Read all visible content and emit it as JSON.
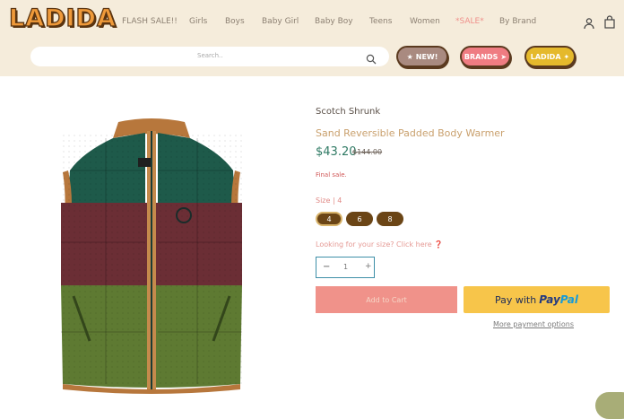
{
  "header": {
    "logo_text": "LADIDA",
    "nav": [
      {
        "label": "FLASH SALE!!"
      },
      {
        "label": "Girls"
      },
      {
        "label": "Boys"
      },
      {
        "label": "Baby Girl"
      },
      {
        "label": "Baby Boy"
      },
      {
        "label": "Teens"
      },
      {
        "label": "Women"
      },
      {
        "label": "*SALE*"
      },
      {
        "label": "By Brand"
      }
    ],
    "icons": {
      "account": "account-icon",
      "cart": "cart-icon"
    },
    "search": {
      "placeholder": "Search..",
      "icon": "search-icon"
    },
    "pills": [
      {
        "label": "NEW!",
        "icon": "star-icon"
      },
      {
        "label": "BRANDS",
        "icon": "arrow-icon"
      },
      {
        "label": "LADIDA",
        "icon": "badge-icon"
      }
    ]
  },
  "product": {
    "brand": "Scotch Shrunk",
    "title": "Sand Reversible Padded Body Warmer",
    "price": "$43.20",
    "compare_price": "$144.00",
    "final_sale": "Final sale.",
    "size_label": "Size | 4",
    "sizes": [
      "4",
      "6",
      "8"
    ],
    "selected_size": "4",
    "size_help": "Looking for your size? Click here ❓",
    "quantity": "1",
    "add_to_cart": "Add to Cart",
    "paypal": {
      "prefix": "Pay with",
      "brand_a": "Pay",
      "brand_b": "Pal"
    },
    "more_payment": "More payment options"
  },
  "colors": {
    "header_bg": "#f5ecdb",
    "price": "#2f7a64",
    "add_to_cart": "#f0928a",
    "paypal": "#f7c54a",
    "size_button": "#6b4516"
  }
}
